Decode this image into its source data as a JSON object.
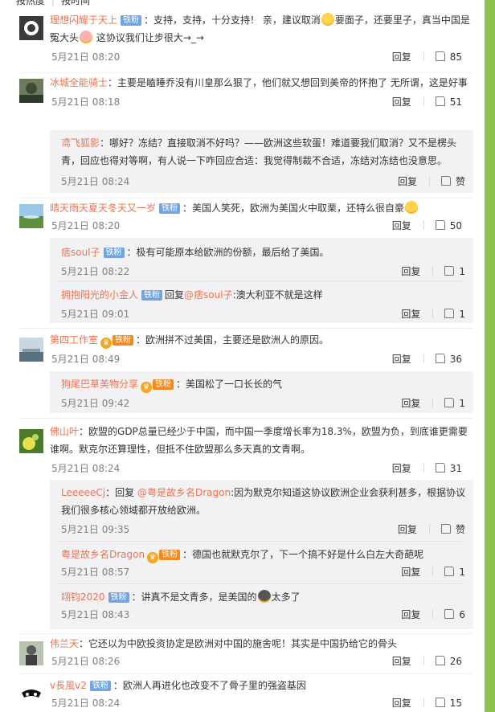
{
  "sort_tabs": {
    "hot": "按热度",
    "time": "按时间"
  },
  "labels": {
    "reply": "回复",
    "like_word": "赞",
    "reply_to": "回复",
    "badge_fans": "铁粉"
  },
  "comments": [
    {
      "user": "理想闪耀于天上",
      "badge": "铁粉",
      "text1": "：支持，支持，十分支持！ 亲，建议取消",
      "text2": "要面子，还要里子，真当中国是冤大头",
      "text3": " 这协议我们让步很大→_→",
      "time": "5月21日 08:20",
      "likes": "85"
    },
    {
      "user": "冰城全能骑士",
      "text": "：主要是瞌睡乔没有川皇那么狠了，他们就又想回到美帝的怀抱了 无所谓，这是好事",
      "time": "5月21日 08:18",
      "likes": "51",
      "replies": [
        {
          "user": "鸢飞狐影",
          "text": "：哪好？冻结？直接取消不好吗？——欧洲这些软蛋！难道要我们取消？又不是楞头青，回应也得对等啊，有人说一下咋回应合适：我觉得制裁不合适，冻结对冻结也没意思。",
          "time": "5月21日 08:24",
          "likes": "赞"
        }
      ]
    },
    {
      "user": "晴天雨天夏天冬天又一岁",
      "badge": "铁粉",
      "text": "：美国人笑死，欧洲为美国火中取栗，还特么很自豪",
      "time": "5月21日 08:20",
      "likes": "50",
      "replies": [
        {
          "user": "痞soul子",
          "badge": "铁粉",
          "text": "：极有可能原本给欧洲的份额，最后给了美国。",
          "time": "5月21日 08:22",
          "likes": "1"
        },
        {
          "user": "拥抱阳光的小金人",
          "badge": "铁粉",
          "reply_target": "@痞soul子",
          "text": ":澳大利亚不就是这样",
          "time": "5月21日 09:01",
          "likes": "1"
        }
      ]
    },
    {
      "user": "第四工作室",
      "badge": "铁粉",
      "text": "：欧洲拼不过美国，主要还是欧洲人的原因。",
      "time": "5月21日 08:49",
      "likes": "36",
      "replies": [
        {
          "user": "狗尾巴草美物分享",
          "badge": "铁粉",
          "text": "：美国松了一口长长的气",
          "time": "5月21日 09:42",
          "likes": "1"
        }
      ]
    },
    {
      "user": "佛山叶",
      "text": "：欧盟的GDP总量已经少于中国，而中国一季度增长率为18.3%，欧盟为负，到底谁更需要谁啊。默克尔还算理性，但抵不住欧盟那么多天真的文青啊。",
      "time": "5月21日 08:24",
      "likes": "31",
      "replies": [
        {
          "user": "LeeeeeCj",
          "reply_target": "@粤是故乡名Dragon",
          "text": ":因为默克尔知道这协议欧洲企业会获利甚多，根据协议我们很多核心领域都开放给欧洲。",
          "time": "5月21日 09:35",
          "likes": "赞"
        },
        {
          "user": "粤是故乡名Dragon",
          "badge": "铁粉",
          "text": "：德国也就默克尔了，下一个搞不好是什么白左大奇葩呢",
          "time": "5月21日 08:57",
          "likes": "1"
        },
        {
          "user": "翊钧2020",
          "badge": "铁粉",
          "text1": "：讲真不是文青多，是美国的",
          "text2": "太多了",
          "time": "5月21日 08:43",
          "likes": "6"
        }
      ]
    },
    {
      "user": "伟兰天",
      "text": "：它还以为中欧投资协定是欧洲对中国的施舍呢！其实是中国扔给它的骨头",
      "time": "5月21日 08:26",
      "likes": "26"
    },
    {
      "user": "v長風v2",
      "badge": "铁粉",
      "text": "：欧洲人再进化也改变不了骨子里的强盗基因",
      "time": "5月21日 08:24",
      "likes": "15"
    }
  ]
}
